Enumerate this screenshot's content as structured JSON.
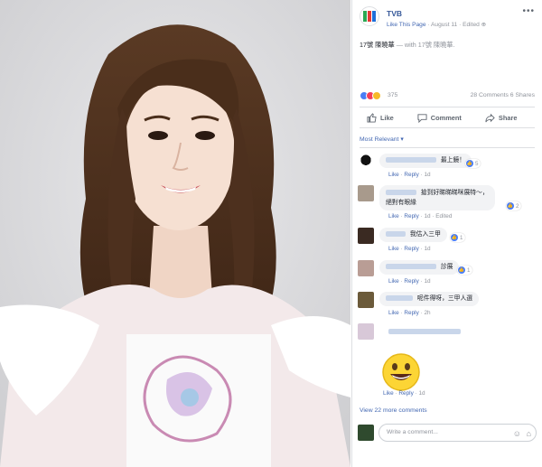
{
  "post": {
    "page_name": "TVB",
    "like_page": "Like This Page",
    "date": "August 11",
    "edited": "Edited",
    "text_main": "17號 陳曉華",
    "text_with": "— with 17號 陳曉華."
  },
  "stats": {
    "reactions_count": "375",
    "comments": "28 Comments",
    "shares": "6 Shares"
  },
  "actions": {
    "like": "Like",
    "comment": "Comment",
    "share": "Share"
  },
  "sort_label": "Most Relevant ▾",
  "comments": [
    {
      "text": "最上鏡！",
      "like": "Like",
      "reply": "Reply",
      "time": "1d",
      "likes": "5"
    },
    {
      "text": "搶到好睇睇睇咪展特～，",
      "text2": "絕對有眼緣",
      "like": "Like",
      "reply": "Reply",
      "time": "1d",
      "edited": "Edited",
      "likes": "2"
    },
    {
      "text": "我估入三甲",
      "like": "Like",
      "reply": "Reply",
      "time": "1d",
      "likes": "1"
    },
    {
      "text": "診展",
      "like": "Like",
      "reply": "Reply",
      "time": "1d",
      "likes": "1"
    },
    {
      "text": "呢件得呀，三甲人選",
      "like": "Like",
      "reply": "Reply",
      "time": "2h"
    },
    {
      "emoji": "😀",
      "like": "Like",
      "reply": "Reply",
      "time": "1d"
    }
  ],
  "view_more": "View 22 more comments",
  "write_placeholder": "Write a comment...",
  "colors": {
    "fb_blue": "#4267b2",
    "link": "#365899",
    "gray": "#90949c"
  }
}
